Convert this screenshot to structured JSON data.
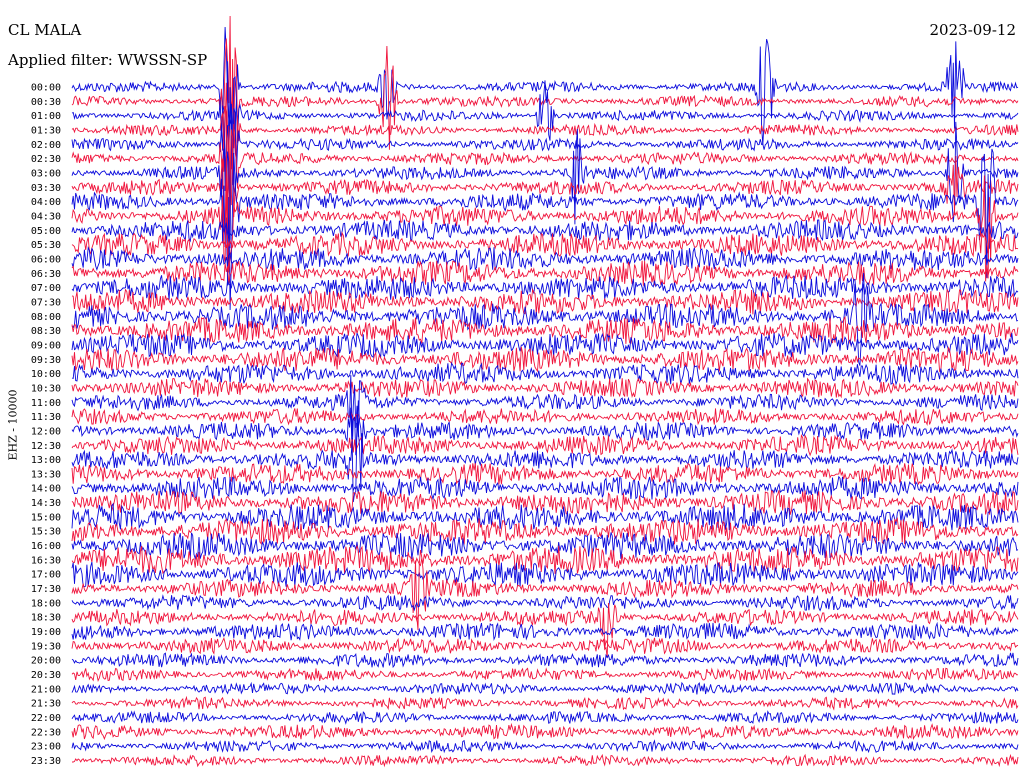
{
  "header": {
    "station": "CL MALA",
    "filter": "Applied filter: WWSSN-SP",
    "date": "2023-09-12"
  },
  "axis": {
    "ylabel": "EHZ - 10000"
  },
  "colors": {
    "odd_trace": "#0a0adc",
    "even_trace": "#f0143c",
    "background": "#ffffff"
  },
  "chart_data": {
    "type": "line",
    "title": "",
    "subtitle": "",
    "ylabel": "EHZ - 10000",
    "xlabel": "",
    "grid": false,
    "trace_minutes": 30,
    "tick_labels": [
      "00:00",
      "00:30",
      "01:00",
      "01:30",
      "02:00",
      "02:30",
      "03:00",
      "03:30",
      "04:00",
      "04:30",
      "05:00",
      "05:30",
      "06:00",
      "06:30",
      "07:00",
      "07:30",
      "08:00",
      "08:30",
      "09:00",
      "09:30",
      "10:00",
      "10:30",
      "11:00",
      "11:30",
      "12:00",
      "12:30",
      "13:00",
      "13:30",
      "14:00",
      "14:30",
      "15:00",
      "15:30",
      "16:00",
      "16:30",
      "17:00",
      "17:30",
      "18:00",
      "18:30",
      "19:00",
      "19:30",
      "20:00",
      "20:30",
      "21:00",
      "21:30",
      "22:00",
      "22:30",
      "23:00",
      "23:30"
    ],
    "noise_level": [
      0.3,
      0.3,
      0.3,
      0.3,
      0.35,
      0.4,
      0.45,
      0.55,
      0.7,
      0.85,
      0.9,
      1.0,
      1.0,
      1.1,
      1.1,
      1.1,
      1.2,
      1.2,
      1.1,
      1.1,
      0.9,
      0.8,
      0.6,
      0.6,
      0.7,
      0.8,
      0.8,
      0.9,
      1.0,
      1.1,
      1.2,
      1.2,
      1.2,
      1.3,
      1.1,
      0.7,
      0.55,
      0.6,
      0.7,
      0.6,
      0.5,
      0.4,
      0.35,
      0.35,
      0.35,
      0.5,
      0.35,
      0.3
    ],
    "events": [
      {
        "trace": 0,
        "minute": 5,
        "amplitude": 7
      },
      {
        "trace": 1,
        "minute": 5,
        "amplitude": 7
      },
      {
        "trace": 2,
        "minute": 5,
        "amplitude": 6
      },
      {
        "trace": 3,
        "minute": 5,
        "amplitude": 6
      },
      {
        "trace": 4,
        "minute": 5,
        "amplitude": 6
      },
      {
        "trace": 5,
        "minute": 5,
        "amplitude": 6
      },
      {
        "trace": 6,
        "minute": 5,
        "amplitude": 6
      },
      {
        "trace": 7,
        "minute": 5,
        "amplitude": 6
      },
      {
        "trace": 8,
        "minute": 5,
        "amplitude": 8
      },
      {
        "trace": 9,
        "minute": 5,
        "amplitude": 5
      },
      {
        "trace": 0,
        "minute": 10,
        "amplitude": 3
      },
      {
        "trace": 1,
        "minute": 10,
        "amplitude": 5
      },
      {
        "trace": 2,
        "minute": 15,
        "amplitude": 3
      },
      {
        "trace": 6,
        "minute": 16,
        "amplitude": 4
      },
      {
        "trace": 6,
        "minute": 28,
        "amplitude": 4
      },
      {
        "trace": 7,
        "minute": 28,
        "amplitude": 3
      },
      {
        "trace": 0,
        "minute": 28,
        "amplitude": 4
      },
      {
        "trace": 0,
        "minute": 22,
        "amplitude": 5
      },
      {
        "trace": 8,
        "minute": 29,
        "amplitude": 8
      },
      {
        "trace": 9,
        "minute": 29,
        "amplitude": 5
      },
      {
        "trace": 16,
        "minute": 25,
        "amplitude": 4
      },
      {
        "trace": 22,
        "minute": 9,
        "amplitude": 3
      },
      {
        "trace": 24,
        "minute": 9,
        "amplitude": 3
      },
      {
        "trace": 26,
        "minute": 9,
        "amplitude": 3
      },
      {
        "trace": 35,
        "minute": 11,
        "amplitude": 3
      },
      {
        "trace": 37,
        "minute": 17,
        "amplitude": 3
      }
    ]
  }
}
